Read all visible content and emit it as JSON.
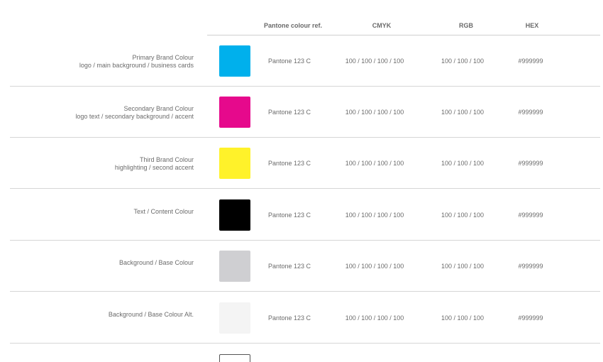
{
  "header": {
    "pantone": "Pantone colour ref.",
    "cmyk": "CMYK",
    "rgb": "RGB",
    "hex": "HEX"
  },
  "rows": [
    {
      "name": "Primary Brand Colour",
      "usage": "logo / main background / business cards",
      "swatch_color": "#00b0ec",
      "pantone": "Pantone 123 C",
      "cmyk": "100 / 100 / 100 / 100",
      "rgb": "100 / 100 / 100",
      "hex": "#999999"
    },
    {
      "name": "Secondary Brand Colour",
      "usage": "logo text / secondary background / accent",
      "swatch_color": "#e6098c",
      "pantone": "Pantone 123 C",
      "cmyk": "100 / 100 / 100 / 100",
      "rgb": "100 / 100 / 100",
      "hex": "#999999"
    },
    {
      "name": "Third Brand Colour",
      "usage": "highlighting / second accent",
      "swatch_color": "#fff22a",
      "pantone": "Pantone 123 C",
      "cmyk": "100 / 100 / 100 / 100",
      "rgb": "100 / 100 / 100",
      "hex": "#999999"
    },
    {
      "name": "Text / Content Colour",
      "usage": "",
      "swatch_color": "#000000",
      "pantone": "Pantone 123 C",
      "cmyk": "100 / 100 / 100 / 100",
      "rgb": "100 / 100 / 100",
      "hex": "#999999"
    },
    {
      "name": "Background / Base Colour",
      "usage": "",
      "swatch_color": "#cfcfd2",
      "pantone": "Pantone 123 C",
      "cmyk": "100 / 100 / 100 / 100",
      "rgb": "100 / 100 / 100",
      "hex": "#999999"
    },
    {
      "name": "Background / Base Colour Alt.",
      "usage": "",
      "swatch_color": "#f4f4f4",
      "pantone": "Pantone 123 C",
      "cmyk": "100 / 100 / 100 / 100",
      "rgb": "100 / 100 / 100",
      "hex": "#999999"
    }
  ]
}
